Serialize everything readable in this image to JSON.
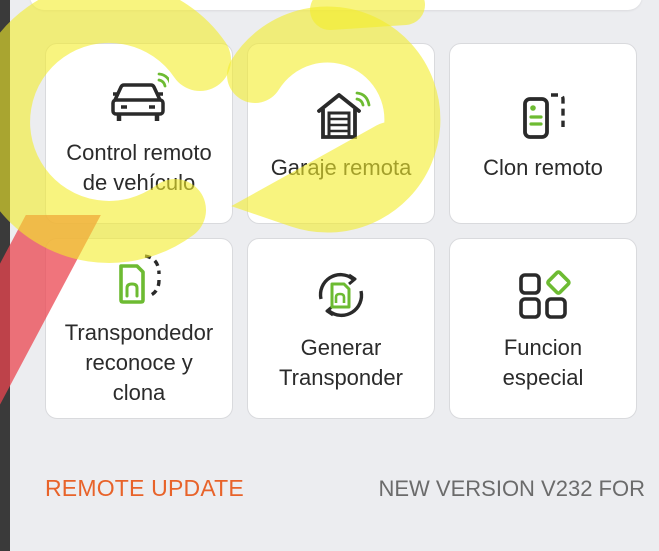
{
  "tiles": [
    {
      "label": "Control remoto\nde vehículo",
      "icon": "car-remote-icon"
    },
    {
      "label": "Garaje remota",
      "icon": "garage-remote-icon"
    },
    {
      "label": "Clon remoto",
      "icon": "remote-clone-icon"
    },
    {
      "label": "Transpondedor\nreconoce y\nclona",
      "icon": "transponder-clone-icon"
    },
    {
      "label": "Generar\nTransponder",
      "icon": "transponder-generate-icon"
    },
    {
      "label": "Funcion\nespecial",
      "icon": "special-function-icon"
    }
  ],
  "footer": {
    "update_label": "REMOTE UPDATE",
    "version_text": "NEW VERSION V232 FOR"
  },
  "colors": {
    "icon_dark": "#2a2a2a",
    "icon_accent": "#6dbb32",
    "update_orange": "#e8632a",
    "watermark_yellow": "#f4ec2a",
    "watermark_red": "#eb4650"
  }
}
